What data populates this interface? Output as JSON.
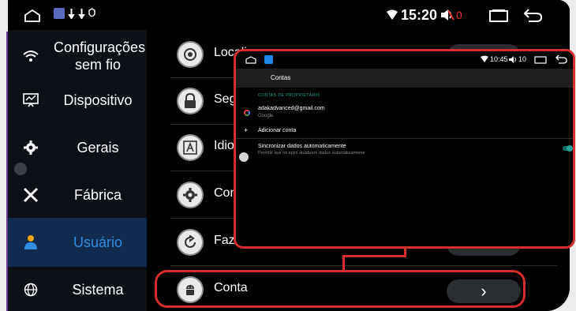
{
  "statusbar": {
    "time": "15:20",
    "volume": "0",
    "icons": [
      "home-icon",
      "app-icon",
      "notification-icon",
      "wifi-icon",
      "volume-muted-icon",
      "recent-apps-icon",
      "back-icon"
    ]
  },
  "sidebar": {
    "items": [
      {
        "label": "Configurações sem fio",
        "icon": "wifi-icon"
      },
      {
        "label": "Dispositivo",
        "icon": "monitor-icon"
      },
      {
        "label": "Gerais",
        "icon": "gear-icon"
      },
      {
        "label": "Fábrica",
        "icon": "tools-icon"
      },
      {
        "label": "Usuário",
        "icon": "user-icon",
        "active": true
      },
      {
        "label": "Sistema",
        "icon": "globe-icon"
      }
    ]
  },
  "main": {
    "rows": [
      {
        "label": "Locali",
        "icon": "location-icon"
      },
      {
        "label": "Segu",
        "icon": "lock-icon"
      },
      {
        "label": "Idion",
        "icon": "language-icon"
      },
      {
        "label": "Conf",
        "icon": "gear-icon"
      },
      {
        "label": "Fazer backup e redefini",
        "icon": "restore-icon"
      },
      {
        "label": "Conta",
        "icon": "android-icon"
      }
    ],
    "arrow": "›"
  },
  "overlay": {
    "status_time": "10:45",
    "status_volume": "10",
    "title": "Contas",
    "section": "CONTAS DE PROPRIETÁRIO",
    "account_email": "adakadvanced@gmail.com",
    "account_type": "Google",
    "add_account": "Adicionar conta",
    "sync_title": "Sincronizar dados automaticamente",
    "sync_subtitle": "Permitir que os apps atualizem dados automaticamente",
    "sync_enabled": true
  },
  "colors": {
    "highlight": "#d62d2d",
    "active_text": "#2f8de4",
    "active_bg": "#112a4d",
    "toggle": "#26a69a"
  }
}
